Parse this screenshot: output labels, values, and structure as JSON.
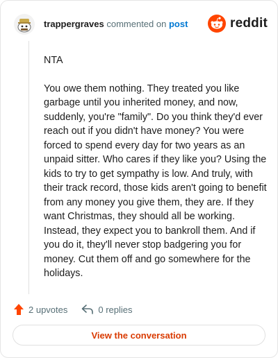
{
  "header": {
    "username": "trappergraves",
    "action_text": "commented on",
    "post_link": "post",
    "brand": "reddit"
  },
  "comment": {
    "paragraphs": [
      "NTA",
      "You owe them nothing. They treated you like garbage until you inherited money, and now, suddenly, you're \"family\". Do you think they'd ever reach out if you didn't have money? You were forced to spend every day for two years as an unpaid sitter. Who cares if they like you? Using the kids to try to get sympathy is low. And truly, with their track record, those kids aren't going to benefit from any money you give them, they are. If they want Christmas, they should all be working. Instead, they expect you to bankroll them. And if you do it, they'll never stop badgering you for money. Cut them off and go somewhere for the holidays."
    ]
  },
  "actions": {
    "upvotes": "2 upvotes",
    "replies": "0 replies"
  },
  "view_button": "View the conversation",
  "colors": {
    "brand_orange": "#ff4500",
    "upvote_orange": "#ff4500",
    "link_blue": "#0079d3",
    "button_text": "#d93a00"
  },
  "icons": {
    "avatar": "snoo-avatar-icon",
    "logo": "reddit-logo-icon",
    "upvote": "upvote-arrow-icon",
    "reply": "reply-arrow-icon"
  }
}
